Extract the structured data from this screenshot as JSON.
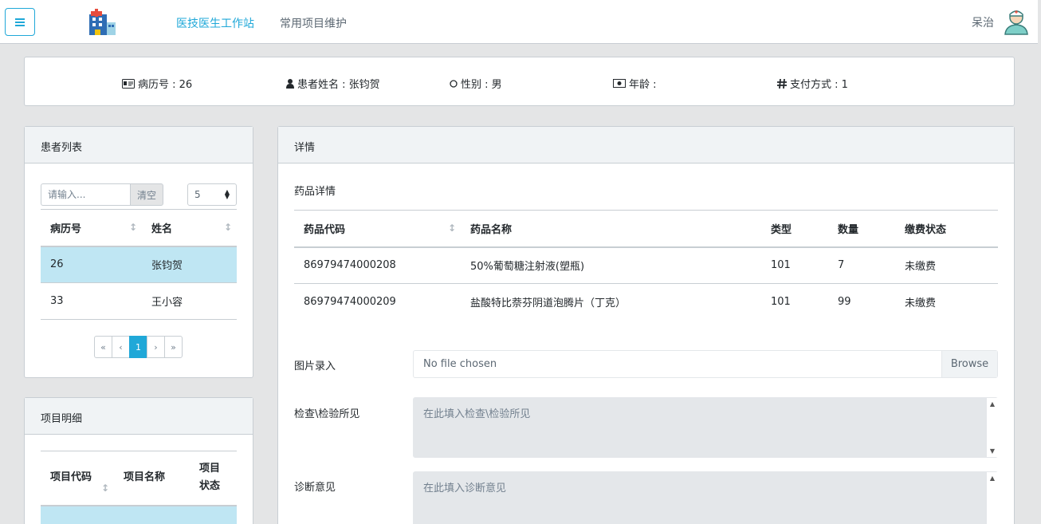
{
  "navbar": {
    "nav_active": "医技医生工作站",
    "nav_plain": "常用项目维护",
    "user_name": "呆治"
  },
  "info": {
    "record_no": "病历号 : 26",
    "patient_name": "患者姓名 : 张钧贺",
    "gender": "性别 : 男",
    "age": "年龄 :",
    "payment": "支付方式 : 1"
  },
  "patient_list": {
    "title": "患者列表",
    "search_placeholder": "请输入...",
    "clear_label": "清空",
    "page_size": "5",
    "columns": [
      "病历号",
      "姓名"
    ],
    "rows": [
      {
        "id": "26",
        "name": "张钧贺"
      },
      {
        "id": "33",
        "name": "王小容"
      }
    ],
    "pagination": [
      "«",
      "‹",
      "1",
      "›",
      "»"
    ]
  },
  "project_detail": {
    "title": "项目明细",
    "columns": [
      "项目代码",
      "项目名称",
      "项目",
      "状态"
    ]
  },
  "detail": {
    "title": "详情",
    "drug_section": "药品详情",
    "columns": [
      "药品代码",
      "药品名称",
      "类型",
      "数量",
      "缴费状态"
    ],
    "rows": [
      {
        "code": "86979474000208",
        "name": "50%葡萄糖注射液(塑瓶)",
        "type": "101",
        "qty": "7",
        "status": "未缴费"
      },
      {
        "code": "86979474000209",
        "name": "盐酸特比萘芬阴道泡腾片（丁克）",
        "type": "101",
        "qty": "99",
        "status": "未缴费"
      }
    ],
    "image_label": "图片录入",
    "file_text": "No file chosen",
    "browse_label": "Browse",
    "exam_label": "检查\\检验所见",
    "exam_placeholder": "在此填入检查\\检验所见",
    "diag_label": "诊断意见",
    "diag_placeholder": "在此填入诊断意见"
  },
  "colors": {
    "primary": "#20a8d8",
    "selected_row": "#bfe6f3",
    "header_bg": "#f0f3f5",
    "page_bg": "#e4e5e6"
  }
}
